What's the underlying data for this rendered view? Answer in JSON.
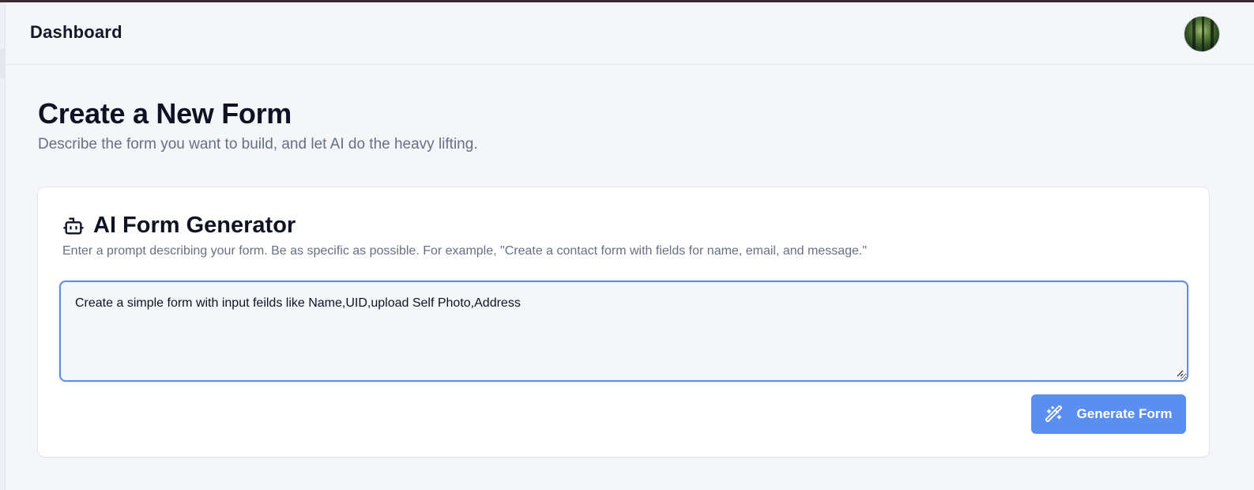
{
  "header": {
    "brand": "Dashboard",
    "avatar_icon": "user-avatar-forest"
  },
  "page": {
    "title": "Create a New Form",
    "subtitle": "Describe the form you want to build, and let AI do the heavy lifting."
  },
  "generator": {
    "icon": "bot-icon",
    "title": "AI Form Generator",
    "description": "Enter a prompt describing your form. Be as specific as possible. For example, \"Create a contact form with fields for name, email, and message.\"",
    "prompt_value": "Create a simple form with input feilds like Name,UID,upload Self Photo,Address",
    "button_label": "Generate Form",
    "button_icon": "magic-wand-icon"
  },
  "colors": {
    "accent": "#5a8ff0",
    "focus_border": "#5f8de6",
    "muted_text": "#667085",
    "background": "#f5f6fa"
  }
}
